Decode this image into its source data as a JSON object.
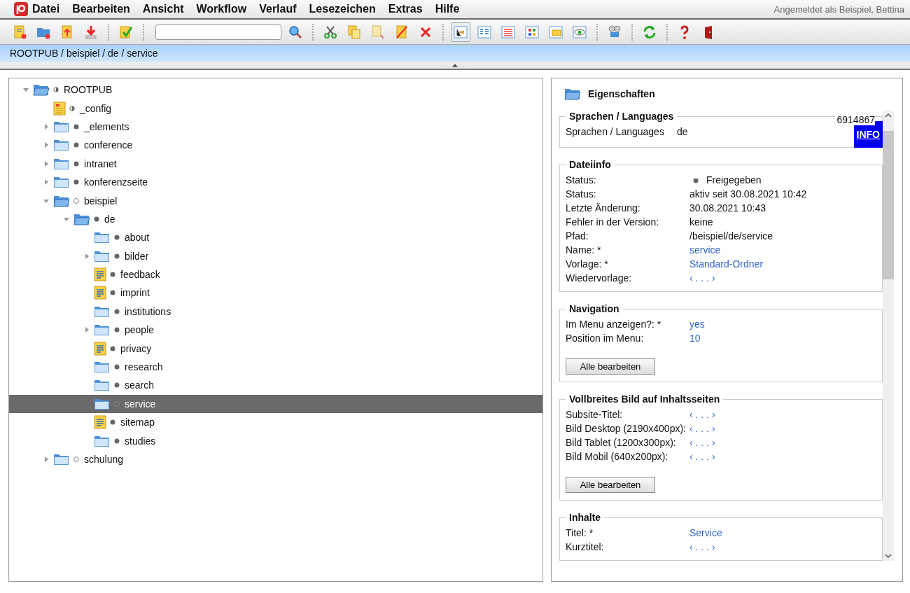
{
  "menu": {
    "items": [
      "Datei",
      "Bearbeiten",
      "Ansicht",
      "Workflow",
      "Verlauf",
      "Lesezeichen",
      "Extras",
      "Hilfe"
    ],
    "user": "Angemeldet als Beispiel, Bettina"
  },
  "toolbar": {
    "view_modes": [
      {
        "selected": true
      },
      {
        "selected": false
      },
      {
        "selected": false
      },
      {
        "selected": false
      },
      {
        "selected": false
      },
      {
        "selected": false
      }
    ]
  },
  "breadcrumb": "ROOTPUB / beispiel / de / service",
  "tree": [
    {
      "label": "ROOTPUB",
      "kind": "folder",
      "expandable": true,
      "expanded": true,
      "published": true,
      "partial": true,
      "selected": false,
      "children": [
        {
          "label": "_config",
          "kind": "config",
          "expandable": false,
          "expanded": false,
          "published": true,
          "partial": true,
          "selected": false
        },
        {
          "label": "_elements",
          "kind": "folder",
          "expandable": true,
          "expanded": false,
          "published": true,
          "partial": false,
          "selected": false
        },
        {
          "label": "conference",
          "kind": "folder",
          "expandable": true,
          "expanded": false,
          "published": true,
          "partial": false,
          "selected": false
        },
        {
          "label": "intranet",
          "kind": "folder",
          "expandable": true,
          "expanded": false,
          "published": true,
          "partial": false,
          "selected": false
        },
        {
          "label": "konferenzseite",
          "kind": "folder",
          "expandable": true,
          "expanded": false,
          "published": true,
          "partial": false,
          "selected": false
        },
        {
          "label": "beispiel",
          "kind": "folder",
          "expandable": true,
          "expanded": true,
          "published": false,
          "partial": false,
          "selected": false,
          "children": [
            {
              "label": "de",
              "kind": "folder",
              "expandable": true,
              "expanded": true,
              "published": true,
              "partial": false,
              "selected": false,
              "children": [
                {
                  "label": "about",
                  "kind": "folder",
                  "expandable": false,
                  "expanded": false,
                  "published": true,
                  "partial": false,
                  "selected": false
                },
                {
                  "label": "bilder",
                  "kind": "folder",
                  "expandable": true,
                  "expanded": false,
                  "published": true,
                  "partial": false,
                  "selected": false
                },
                {
                  "label": "feedback",
                  "kind": "page",
                  "expandable": false,
                  "expanded": false,
                  "published": true,
                  "partial": false,
                  "selected": false
                },
                {
                  "label": "imprint",
                  "kind": "page",
                  "expandable": false,
                  "expanded": false,
                  "published": true,
                  "partial": false,
                  "selected": false
                },
                {
                  "label": "institutions",
                  "kind": "folder",
                  "expandable": false,
                  "expanded": false,
                  "published": true,
                  "partial": false,
                  "selected": false
                },
                {
                  "label": "people",
                  "kind": "folder",
                  "expandable": true,
                  "expanded": false,
                  "published": true,
                  "partial": false,
                  "selected": false
                },
                {
                  "label": "privacy",
                  "kind": "page",
                  "expandable": false,
                  "expanded": false,
                  "published": true,
                  "partial": false,
                  "selected": false
                },
                {
                  "label": "research",
                  "kind": "folder",
                  "expandable": false,
                  "expanded": false,
                  "published": true,
                  "partial": false,
                  "selected": false
                },
                {
                  "label": "search",
                  "kind": "folder",
                  "expandable": false,
                  "expanded": false,
                  "published": true,
                  "partial": false,
                  "selected": false
                },
                {
                  "label": "service",
                  "kind": "folder",
                  "expandable": false,
                  "expanded": false,
                  "published": false,
                  "partial": false,
                  "selected": true
                },
                {
                  "label": "sitemap",
                  "kind": "page",
                  "expandable": false,
                  "expanded": false,
                  "published": true,
                  "partial": false,
                  "selected": false
                },
                {
                  "label": "studies",
                  "kind": "folder",
                  "expandable": false,
                  "expanded": false,
                  "published": true,
                  "partial": false,
                  "selected": false
                }
              ]
            }
          ]
        },
        {
          "label": "schulung",
          "kind": "folder",
          "expandable": true,
          "expanded": false,
          "published": false,
          "partial": false,
          "selected": false
        }
      ]
    }
  ],
  "properties": {
    "title": "Eigenschaften",
    "languages": {
      "title": "Sprachen / Languages",
      "id": "6914867",
      "label": "Sprachen / Languages",
      "value": "de",
      "info": "INFO"
    },
    "sections": [
      {
        "title": "Dateiinfo",
        "rows": [
          {
            "label": "Status:",
            "value": "Freigegeben",
            "kind": "status"
          },
          {
            "label": "Status:",
            "value": "aktiv seit 30.08.2021 10:42",
            "kind": "text"
          },
          {
            "label": "Letzte Änderung:",
            "value": "30.08.2021 10:43",
            "kind": "text"
          },
          {
            "label": "Fehler in der Version:",
            "value": "keine",
            "kind": "text"
          },
          {
            "label": "Pfad:",
            "value": "/beispiel/de/service",
            "kind": "text"
          },
          {
            "label": "Name: *",
            "value": "service",
            "kind": "link"
          },
          {
            "label": "Vorlage: *",
            "value": "Standard-Ordner",
            "kind": "link"
          },
          {
            "label": "Wiedervorlage:",
            "value": "‹ . . . ›",
            "kind": "link"
          }
        ]
      },
      {
        "title": "Navigation",
        "rows": [
          {
            "label": "Im Menu anzeigen?: *",
            "value": "yes",
            "kind": "link"
          },
          {
            "label": "Position im Menu:",
            "value": "10",
            "kind": "link"
          }
        ],
        "button": "Alle bearbeiten"
      },
      {
        "title": "Vollbreites Bild auf Inhaltsseiten",
        "rows": [
          {
            "label": "Subsite-Titel:",
            "value": "‹ . . . ›",
            "kind": "link"
          },
          {
            "label": "Bild Desktop (2190x400px):",
            "value": "‹ . . . ›",
            "kind": "link"
          },
          {
            "label": "Bild Tablet (1200x300px):",
            "value": "‹ . . . ›",
            "kind": "link"
          },
          {
            "label": "Bild Mobil (640x200px):",
            "value": "‹ . . . ›",
            "kind": "link"
          }
        ],
        "button": "Alle bearbeiten"
      },
      {
        "title": "Inhalte",
        "rows": [
          {
            "label": "Titel: *",
            "value": "Service",
            "kind": "link"
          },
          {
            "label": "Kurztitel:",
            "value": "‹ . . . ›",
            "kind": "link"
          }
        ]
      }
    ]
  }
}
